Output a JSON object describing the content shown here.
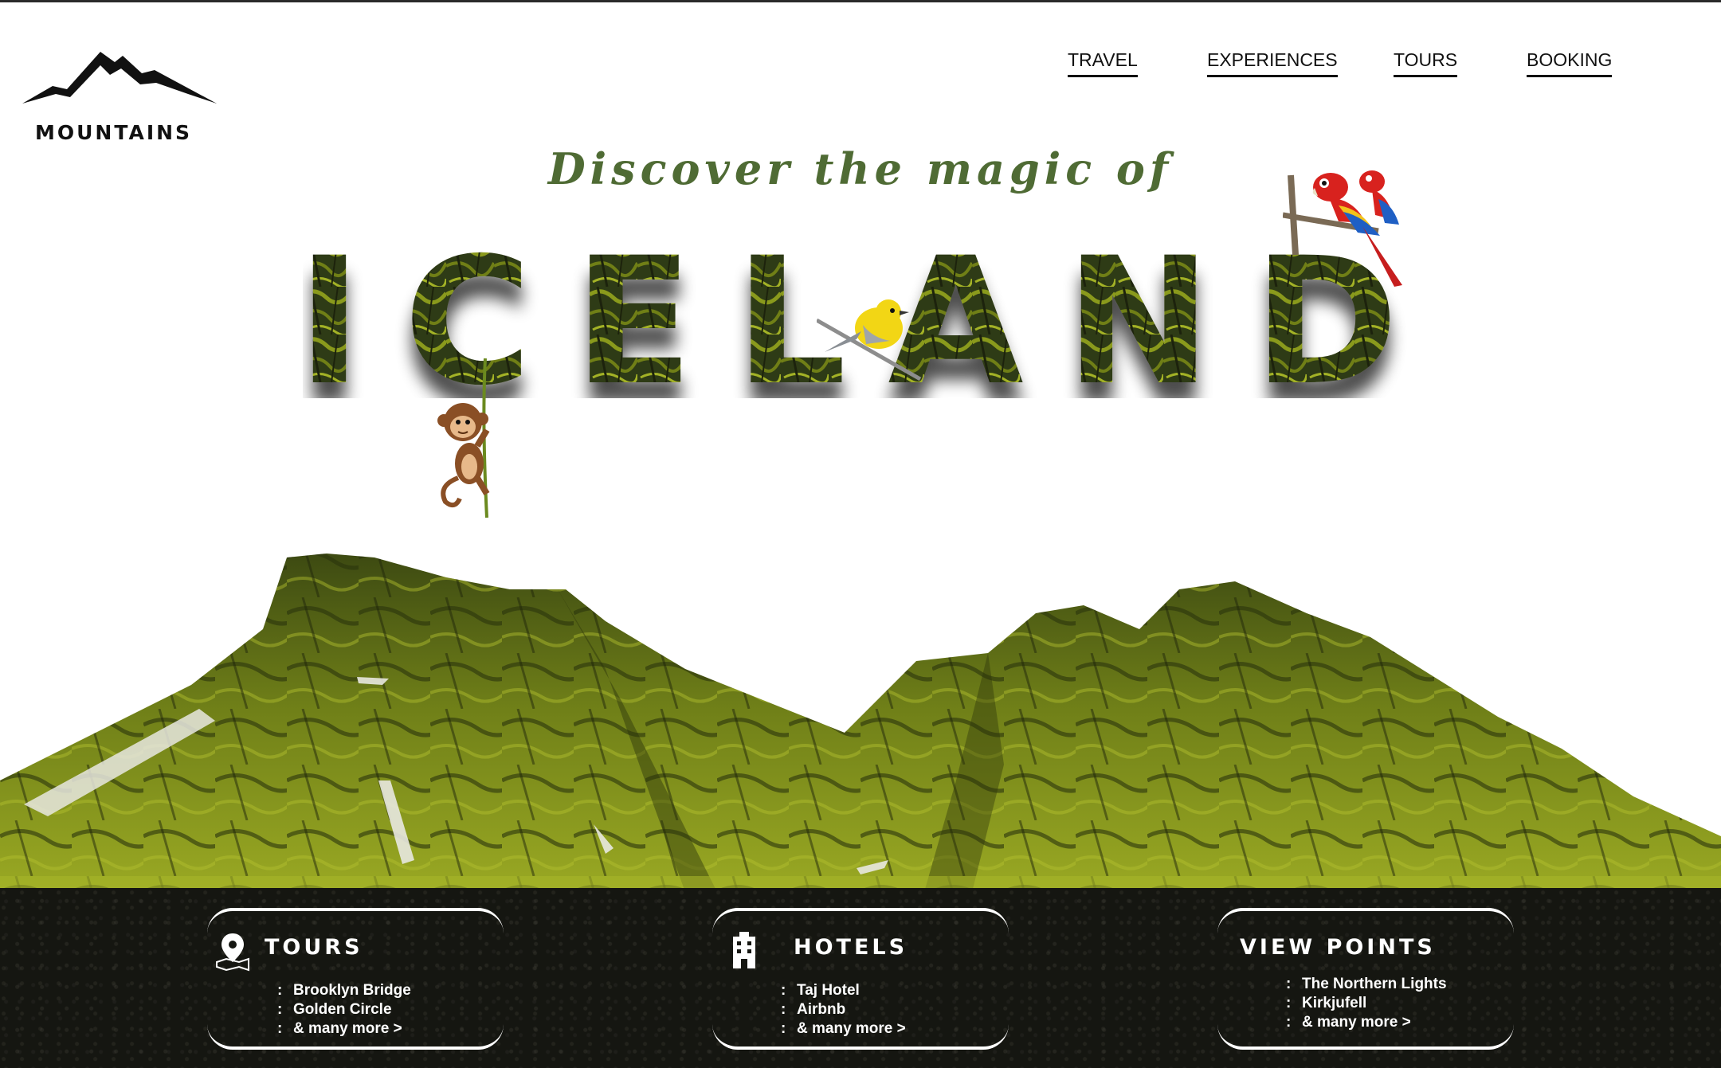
{
  "brand": {
    "name": "MOUNTAINS",
    "logo_icon": "mountain-logo-icon"
  },
  "nav": {
    "items": [
      {
        "label": "TRAVEL"
      },
      {
        "label": "EXPERIENCES"
      },
      {
        "label": "TOURS"
      },
      {
        "label": "BOOKING"
      }
    ]
  },
  "hero": {
    "tagline": "Discover the magic of",
    "headline": "ICELAND",
    "tagline_color": "#4f6b34",
    "headline_color": "#2f3a12"
  },
  "cards": [
    {
      "title": "TOURS",
      "icon": "map-pin-icon",
      "items": [
        "Brooklyn Bridge",
        "Golden Circle"
      ],
      "more": "& many more  >"
    },
    {
      "title": "HOTELS",
      "icon": "building-icon",
      "items": [
        "Taj Hotel",
        "Airbnb"
      ],
      "more": "& many more  >"
    },
    {
      "title": "VIEW POINTS",
      "icon": "",
      "items": [
        "The Northern Lights",
        "Kirkjufell"
      ],
      "more": "& many more  >"
    }
  ],
  "colors": {
    "accent": "#4f6b34",
    "moss": "#8a9a1c",
    "ground": "#151611",
    "text": "#111111"
  }
}
